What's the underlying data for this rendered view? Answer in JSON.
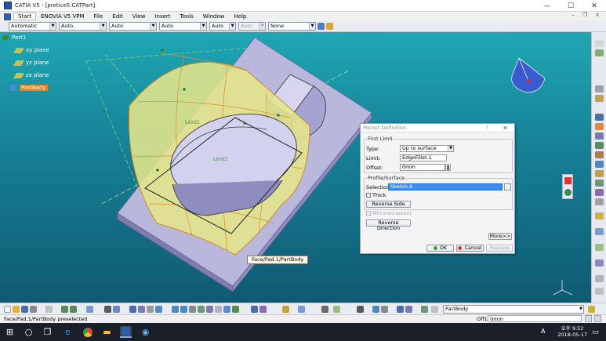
{
  "window": {
    "title": "CATIA V5 - [pretice5.CATPart]",
    "minimize": "—",
    "maximize": "☐",
    "close": "✕"
  },
  "menu": {
    "items": [
      "Start",
      "ENOVIA V5 VPM",
      "File",
      "Edit",
      "View",
      "Insert",
      "Tools",
      "Window",
      "Help"
    ],
    "mdi": [
      "–",
      "❐",
      "×"
    ]
  },
  "toolbar": {
    "combos": [
      {
        "value": "Automatic",
        "enabled": true
      },
      {
        "value": "Auto",
        "enabled": true
      },
      {
        "value": "Auto",
        "enabled": true
      },
      {
        "value": "Auto",
        "enabled": true
      },
      {
        "value": "Auto",
        "enabled": true
      },
      {
        "value": "Auto",
        "enabled": false
      },
      {
        "value": "None",
        "enabled": true
      }
    ]
  },
  "tree": {
    "root": "Part1",
    "items": [
      "xy plane",
      "yz plane",
      "zx plane",
      "PartBody"
    ],
    "selected": "PartBody"
  },
  "viewport": {
    "labels": [
      "Limit1",
      "Limit1"
    ]
  },
  "dialog": {
    "title": "Pocket Definition",
    "help": "?",
    "close": "✕",
    "first_limit": {
      "group": "First Limit",
      "type_label": "Type:",
      "type_value": "Up to surface",
      "limit_label": "Limit:",
      "limit_value": "EdgeFillet.1",
      "offset_label": "Offset:",
      "offset_value": "0mm"
    },
    "profile": {
      "group": "Profile/Surface",
      "selection_label": "Selection:",
      "selection_value": "Sketch.8",
      "thick_label": "Thick",
      "reverse_side": "Reverse Side"
    },
    "mirrored_label": "Mirrored extent",
    "reverse_direction": "Reverse Direction",
    "more": "More>>",
    "ok": "OK",
    "cancel": "Cancel",
    "preview": "Preview"
  },
  "tooltip": "Face/Pad.1/PartBody",
  "bottom": {
    "combo_value": "PartBody"
  },
  "status": {
    "message": "Face/Pad.1/PartBody preselected",
    "offset_label": "Off1",
    "offset_value": "0mm"
  },
  "taskbar": {
    "ime": "A",
    "time": "오후 9:52",
    "date": "2018-05-17"
  },
  "colors": {
    "accent": "#f07d1a",
    "selection": "#3c8ff0",
    "model_gray": "#b8b6d8",
    "viewport": "#1e9fb0"
  }
}
